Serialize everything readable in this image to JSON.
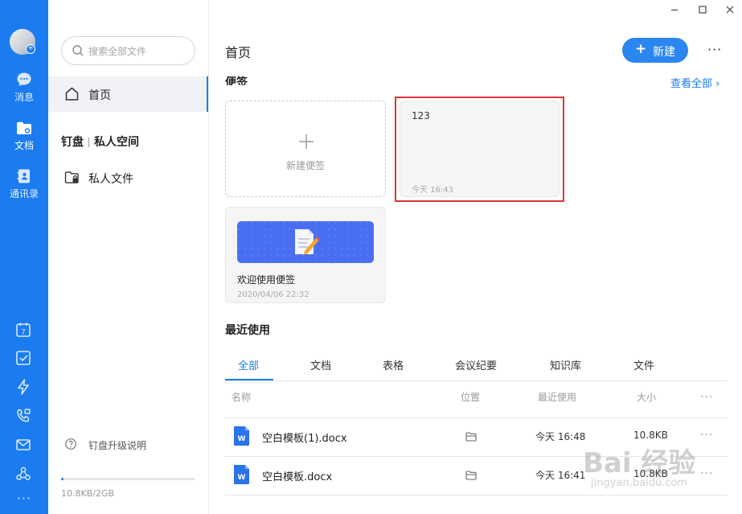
{
  "window": {
    "controls": [
      "minimize",
      "maximize",
      "close"
    ]
  },
  "rail": {
    "items": [
      {
        "label": "消息",
        "icon": "chat-bubble-icon"
      },
      {
        "label": "文档",
        "icon": "document-folder-icon"
      },
      {
        "label": "通讯录",
        "icon": "contacts-book-icon"
      }
    ],
    "tools": [
      "calendar-icon",
      "checkbox-icon",
      "lightning-icon",
      "phone-call-icon",
      "mail-icon",
      "org-chart-icon"
    ],
    "calendar_day": "7",
    "more": "···"
  },
  "nav": {
    "search_placeholder": "搜索全部文件",
    "home": "首页",
    "section_left": "钉盘",
    "section_right": "私人空间",
    "private_files": "私人文件",
    "upgrade": "钉盘升级说明",
    "storage_text": "10.8KB/2GB",
    "storage_fraction": 0.01
  },
  "main": {
    "title": "首页",
    "new_button": "新建",
    "more": "···",
    "notes_heading": "便签",
    "see_all": "查看全部",
    "new_note": "新建便签",
    "note_card": {
      "content": "123",
      "time": "今天 16:43"
    },
    "welcome_card": {
      "title": "欢迎使用便签",
      "time": "2020/04/06 22:32"
    },
    "recent_heading": "最近使用",
    "tabs": [
      "全部",
      "文档",
      "表格",
      "会议纪要",
      "知识库",
      "文件"
    ],
    "columns": {
      "name": "名称",
      "location": "位置",
      "last_used": "最近使用",
      "size": "大小"
    },
    "files": [
      {
        "name": "空白模板(1).docx",
        "last_used": "今天 16:48",
        "size": "10.8KB"
      },
      {
        "name": "空白模板.docx",
        "last_used": "今天 16:41",
        "size": "10.8KB"
      }
    ]
  },
  "colors": {
    "accent": "#1a7cf0",
    "highlight": "#e03434",
    "banner": "#4a6ef1"
  },
  "watermark": {
    "big": "Bai 经验",
    "small": "jingyan.baidu.com"
  }
}
